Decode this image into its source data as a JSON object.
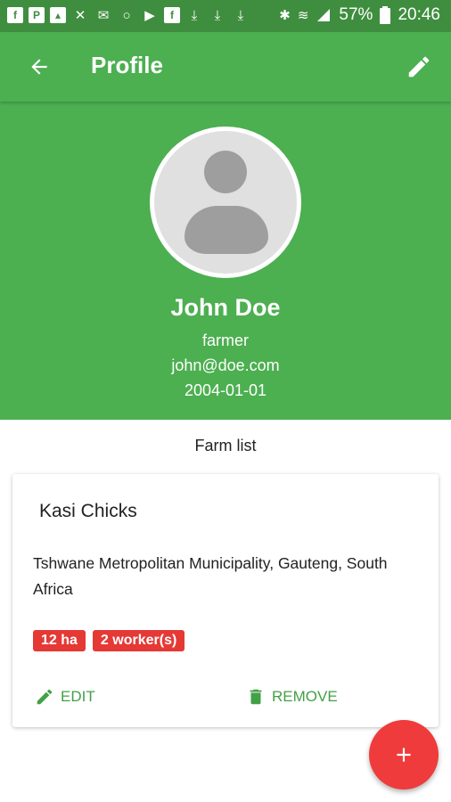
{
  "status_bar": {
    "left_icons": [
      "facebook-icon",
      "photo-app-icon",
      "gallery-icon",
      "tools-icon",
      "mail-icon",
      "circle-icon",
      "flipboard-icon",
      "facebook-icon",
      "download-icon",
      "download-icon",
      "download-icon"
    ],
    "battery": "57%",
    "time": "20:46"
  },
  "app_bar": {
    "title": "Profile"
  },
  "profile": {
    "name": "John Doe",
    "role": "farmer",
    "email": "john@doe.com",
    "dob": "2004-01-01"
  },
  "farm_list": {
    "label": "Farm list",
    "farms": [
      {
        "name": "Kasi Chicks",
        "address": "Tshwane Metropolitan Municipality, Gauteng, South Africa",
        "size_badge": "12 ha",
        "workers_badge": "2 worker(s)",
        "edit_label": "EDIT",
        "remove_label": "REMOVE"
      }
    ]
  },
  "colors": {
    "primary": "#4caf50",
    "status_bar": "#3f8e3f",
    "accent": "#ef3b3b",
    "badge": "#e53935",
    "action_text": "#43a047"
  },
  "fab": {
    "icon": "plus-icon"
  }
}
